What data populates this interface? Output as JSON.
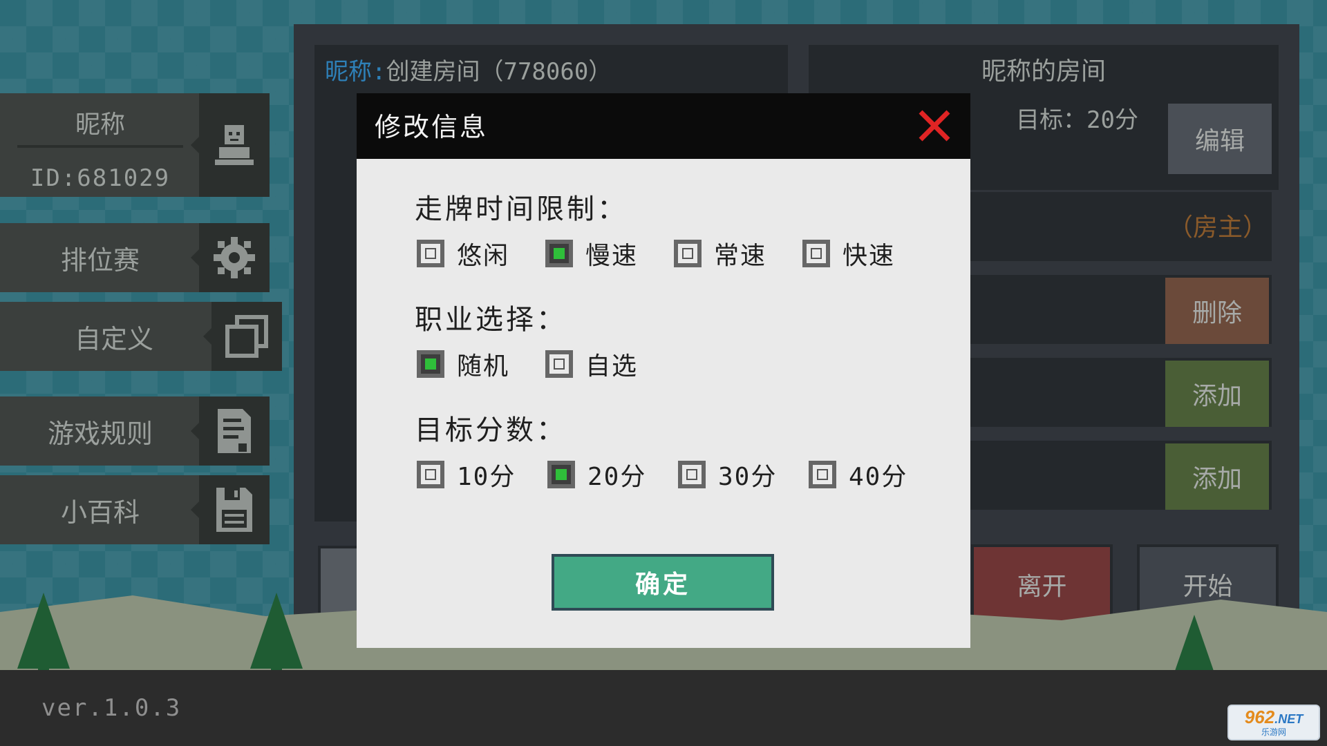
{
  "profile": {
    "name": "昵称",
    "id_label": "ID:681029"
  },
  "menu": [
    {
      "label": "排位赛",
      "icon": "gear-icon"
    },
    {
      "label": "自定义",
      "icon": "copy-icon"
    },
    {
      "label": "游戏规则",
      "icon": "document-icon"
    },
    {
      "label": "小百科",
      "icon": "floppy-icon"
    }
  ],
  "room": {
    "left_title_nick": "昵称:",
    "left_title_rest": "创建房间（778060）",
    "right_title": "昵称的房间",
    "target": "目标：20分",
    "edit_label": "编辑",
    "host_tag": "（房主）",
    "delete_label": "删除",
    "add_label_1": "添加",
    "add_label_2": "添加",
    "leave_label": "离开",
    "start_label": "开始"
  },
  "modal": {
    "title": "修改信息",
    "sections": [
      {
        "title": "走牌时间限制：",
        "options": [
          {
            "label": "悠闲",
            "checked": false
          },
          {
            "label": "慢速",
            "checked": true
          },
          {
            "label": "常速",
            "checked": false
          },
          {
            "label": "快速",
            "checked": false
          }
        ]
      },
      {
        "title": "职业选择：",
        "options": [
          {
            "label": "随机",
            "checked": true
          },
          {
            "label": "自选",
            "checked": false
          }
        ]
      },
      {
        "title": "目标分数：",
        "options": [
          {
            "label": "10分",
            "checked": false
          },
          {
            "label": "20分",
            "checked": true
          },
          {
            "label": "30分",
            "checked": false
          },
          {
            "label": "40分",
            "checked": false
          }
        ]
      }
    ],
    "confirm_label": "确定"
  },
  "version": "ver.1.0.3",
  "watermark": {
    "brand": "962",
    "suffix": ".NET",
    "sub": "乐游网"
  },
  "colors": {
    "checked": "#2fbf3a",
    "confirm": "#43a985",
    "close": "#e02424",
    "nick": "#2e80b8"
  }
}
